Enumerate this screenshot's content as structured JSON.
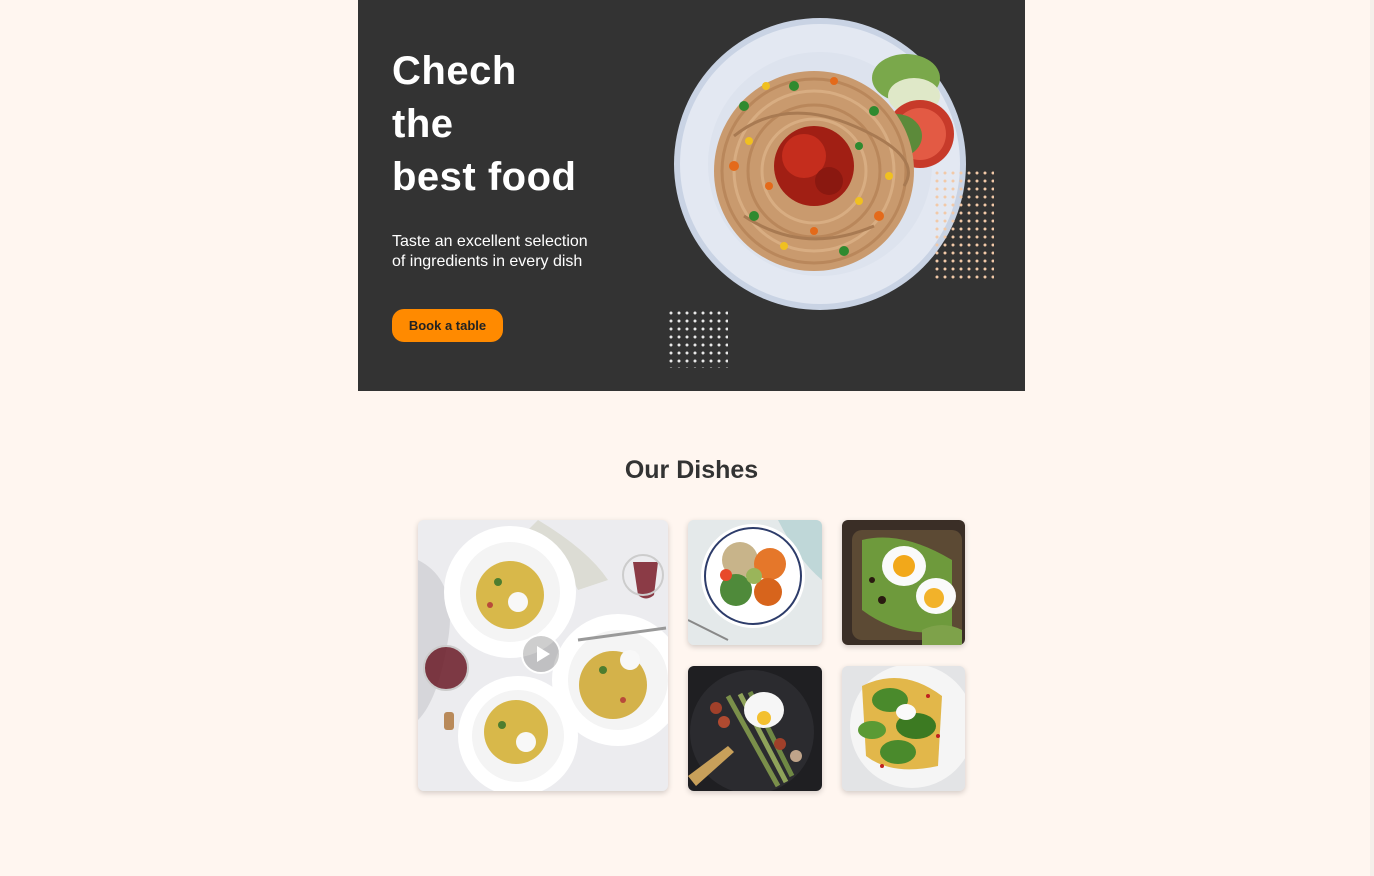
{
  "hero": {
    "title_lines": [
      "Chech",
      "the",
      "best food"
    ],
    "subtitle": "Taste an excellent selection of ingredients in every dish",
    "cta_label": "Book a table",
    "colors": {
      "background": "#333333",
      "accent": "#ff8a00",
      "text": "#ffffff"
    }
  },
  "dishes": {
    "title": "Our Dishes",
    "cards": [
      {
        "name": "pasta-table-photo",
        "has_play_icon": true
      },
      {
        "name": "veggie-bowl-photo"
      },
      {
        "name": "egg-avocado-toast-photo"
      },
      {
        "name": "asparagus-poached-egg-photo"
      },
      {
        "name": "spinach-egg-toast-photo"
      }
    ]
  },
  "icons": [
    "play-icon",
    "dot-grid-decoration"
  ],
  "page": {
    "background": "#fff6f0"
  }
}
